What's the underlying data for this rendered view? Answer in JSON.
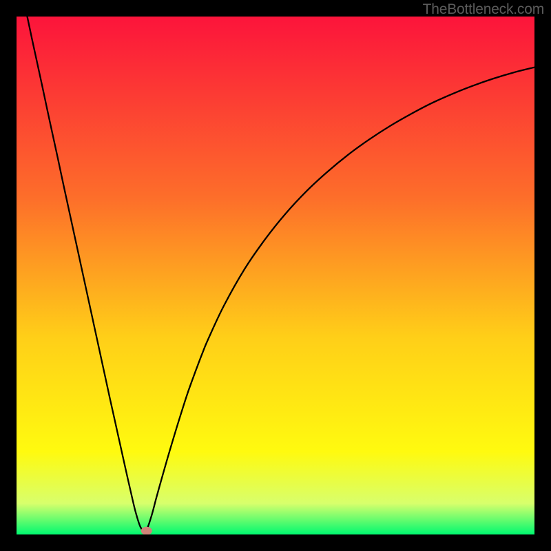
{
  "attribution": "TheBottleneck.com",
  "colors": {
    "black": "#000000",
    "gradient_top": "#fc143b",
    "gradient_mid1": "#fd6e2a",
    "gradient_mid2": "#ffcf18",
    "gradient_low1": "#fffa0f",
    "gradient_low2": "#d8ff6c",
    "gradient_bottom": "#00f970",
    "curve_stroke": "#000000",
    "marker_fill": "#cf8479",
    "marker_stroke": "#b36b60"
  },
  "chart_data": {
    "type": "line",
    "title": "",
    "xlabel": "",
    "ylabel": "",
    "xlim": [
      0,
      100
    ],
    "ylim": [
      0,
      100
    ],
    "x": [
      0,
      1,
      2,
      3,
      4,
      5,
      6,
      7,
      8,
      9,
      10,
      11,
      12,
      13,
      14,
      15,
      16,
      17,
      18,
      19,
      20,
      21,
      22,
      23,
      24,
      25,
      26,
      27,
      28,
      29,
      30,
      31,
      32,
      33,
      34,
      35,
      36,
      37,
      40,
      44,
      48,
      52,
      56,
      60,
      64,
      68,
      72,
      76,
      80,
      84,
      88,
      92,
      96,
      100
    ],
    "values": [
      110,
      104.9,
      100.3,
      95.6,
      91,
      86.4,
      81.7,
      77.1,
      72.5,
      67.8,
      63.2,
      58.6,
      54,
      49.4,
      44.8,
      40.2,
      35.6,
      31,
      26.4,
      21.9,
      17.4,
      12.9,
      8.5,
      4.3,
      1.3,
      0.8,
      3.4,
      7.1,
      10.7,
      14.2,
      17.6,
      20.9,
      24.1,
      27.2,
      30,
      32.7,
      35.3,
      37.7,
      44.1,
      51.2,
      57,
      62,
      66.3,
      70,
      73.3,
      76.2,
      78.8,
      81.1,
      83.2,
      85,
      86.6,
      88,
      89.2,
      90.2
    ],
    "marker": {
      "x": 25.1,
      "y": 0.7
    }
  }
}
